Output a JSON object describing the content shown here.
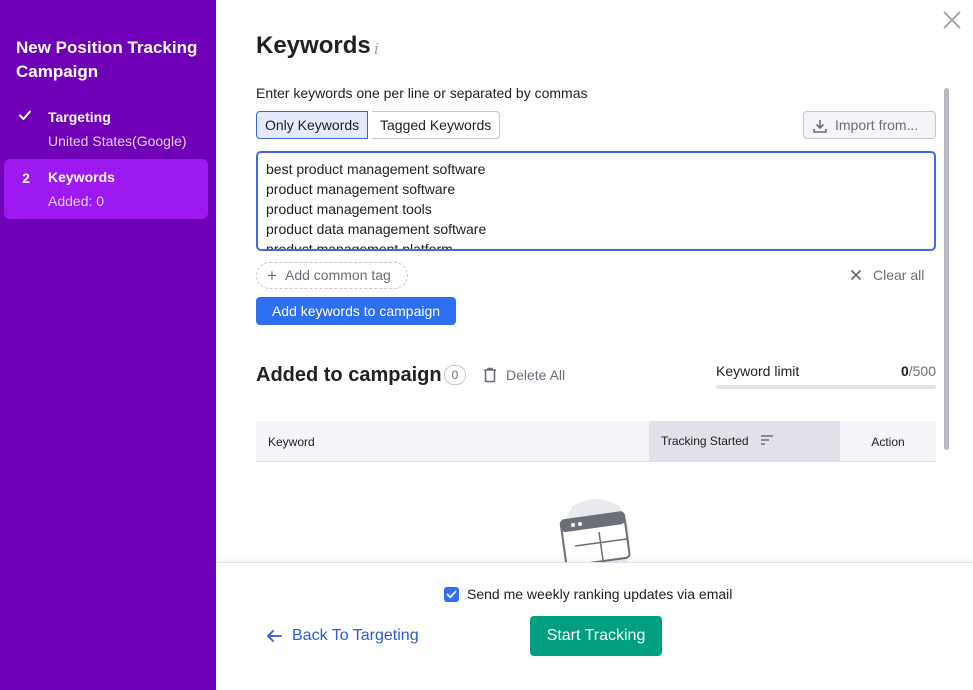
{
  "sidebar": {
    "title": "New Position Tracking Campaign",
    "steps": [
      {
        "number": "",
        "label": "Targeting",
        "sub": "United States(Google)",
        "status": "done"
      },
      {
        "number": "2",
        "label": "Keywords",
        "sub": "Added: 0",
        "status": "active"
      }
    ]
  },
  "main": {
    "title": "Keywords",
    "info_icon": "i",
    "instructions": "Enter keywords one per line or separated by commas",
    "tabs": [
      "Only Keywords",
      "Tagged Keywords"
    ],
    "import_label": "Import from...",
    "keywords": [
      "best product management software",
      "product management software",
      "product management tools",
      "product data management software",
      "product management platform"
    ],
    "add_tag_label": "Add common tag",
    "clear_all_label": "Clear all",
    "add_button_label": "Add keywords to campaign"
  },
  "campaign": {
    "title": "Added to campaign",
    "count": "0",
    "delete_all_label": "Delete All",
    "limit_label": "Keyword limit",
    "limit_used": "0",
    "limit_total": "/500",
    "limit_fraction": 0,
    "columns": [
      "Keyword",
      "Tracking Started",
      "Action"
    ]
  },
  "footer": {
    "email_label": "Send me weekly ranking updates via email",
    "email_checked": true,
    "back_label": "Back To Targeting",
    "start_label": "Start Tracking"
  },
  "colors": {
    "sidebar_bg": "#7000b8",
    "active_step_bg": "#9c19f0",
    "primary_blue": "#2e6ff2",
    "start_green": "#009f81"
  }
}
